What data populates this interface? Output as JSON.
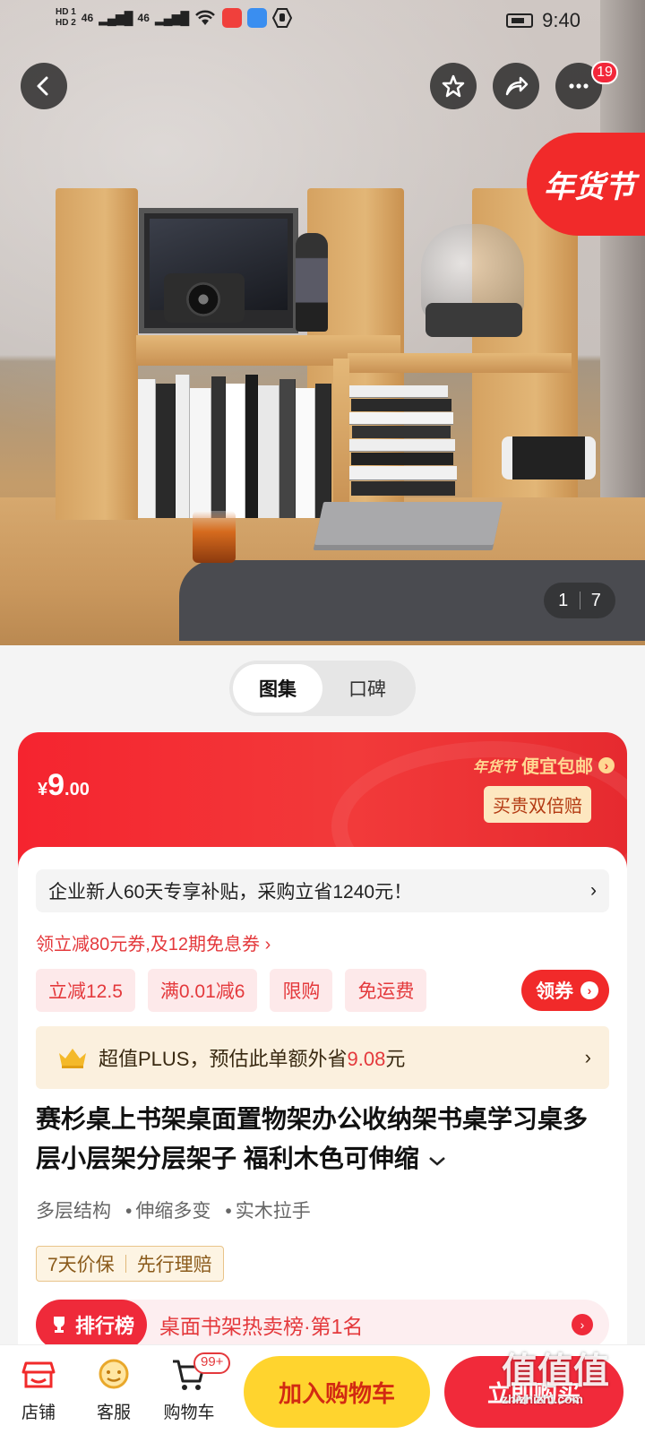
{
  "status_bar": {
    "sim1": "HD 1",
    "sim2": "HD 2",
    "net1": "46",
    "net2": "46",
    "time": "9:40"
  },
  "header": {
    "back_icon": "arrow-left-icon",
    "favorite_icon": "star-icon",
    "share_icon": "share-icon",
    "more_icon": "more-dots-icon",
    "more_badge": "19",
    "festival_tag": "年货节"
  },
  "gallery": {
    "current": "1",
    "total": "7"
  },
  "tabs": [
    "图集",
    "口碑"
  ],
  "active_tab": 0,
  "price": {
    "symbol": "¥",
    "integer": "9",
    "decimal": ".00",
    "campaign_tag": "年货节",
    "campaign_text": "便宜包邮",
    "guarantee": "买贵双倍赔"
  },
  "subsidy": {
    "text": "企业新人60天专享补贴，采购立省1240元！",
    "chevron": "›"
  },
  "coupon_link": "领立减80元券,及12期免息券 ›",
  "promo_tags": [
    "立减12.5",
    "满0.01减6",
    "限购",
    "免运费"
  ],
  "get_coupon": "领券",
  "plus": {
    "prefix": "超值PLUS，预估此单额外省",
    "amount": "9.08",
    "suffix": "元",
    "chevron": "›"
  },
  "product": {
    "title": "赛杉桌上书架桌面置物架办公收纳架书桌学习桌多层小层架分层架子 福利木色可伸缩",
    "expand_icon": "chevron-down-icon",
    "features": [
      "多层结构",
      "伸缩多变",
      "实木拉手"
    ],
    "guarantees": [
      "7天价保",
      "先行理赔"
    ]
  },
  "ranking": {
    "label": "排行榜",
    "text": "桌面书架热卖榜·第1名"
  },
  "bottom_bar": {
    "shop": "店铺",
    "service": "客服",
    "cart": "购物车",
    "cart_badge": "99+",
    "add_to_cart": "加入购物车",
    "buy_now": "立即购买"
  },
  "watermark": {
    "logo": "值值值",
    "site": "zhizhizhi.com"
  },
  "colors": {
    "accent_red": "#f12a2a",
    "cart_yellow": "#ffd42e",
    "price_text": "#e4393c"
  }
}
